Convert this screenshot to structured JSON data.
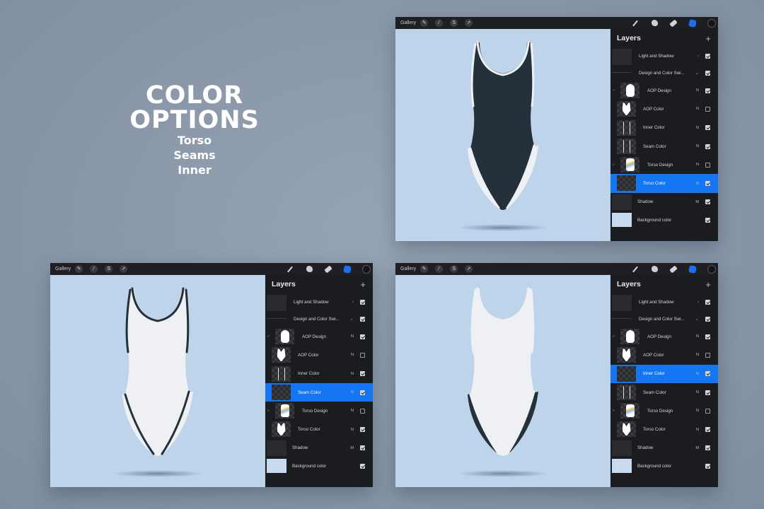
{
  "headline": {
    "title_line1": "COLOR",
    "title_line2": "OPTIONS",
    "options": [
      "Torso",
      "Seams",
      "Inner"
    ]
  },
  "colors": {
    "background": "#8896a8",
    "canvas": "#bdd4ea",
    "toolbar": "#1e1f22",
    "layers_panel": "#1b1c1f",
    "selection": "#1476f2",
    "dark_fabric": "#24303a",
    "light_fabric": "#eef0f3"
  },
  "toolbar": {
    "gallery_label": "Gallery",
    "left_icons": [
      "wrench-icon",
      "magic-wand-icon",
      "selection-s-icon",
      "transform-arrow-icon"
    ],
    "right_icons": [
      "brush-icon",
      "smudge-icon",
      "eraser-icon",
      "layers-icon",
      "color-picker-icon"
    ]
  },
  "panels": [
    {
      "id": "torso",
      "suit": {
        "body": "dark",
        "seams": "light",
        "inner": "light"
      },
      "layers_title": "Layers",
      "add_label": "+",
      "selected_layer": "Torso Color"
    },
    {
      "id": "seams",
      "suit": {
        "body": "light",
        "seams": "dark",
        "inner": "light"
      },
      "layers_title": "Layers",
      "add_label": "+",
      "selected_layer": "Seam Color"
    },
    {
      "id": "inner",
      "suit": {
        "body": "light",
        "seams": "light",
        "inner": "dark"
      },
      "layers_title": "Layers",
      "add_label": "+",
      "selected_layer": "Inner Color"
    }
  ],
  "layers": [
    {
      "name": "Light and Shadow",
      "blend": "",
      "chevron": ">",
      "visible": true,
      "type": "group-closed"
    },
    {
      "name": "Design and Color Swi...",
      "blend": "",
      "chevron": "v",
      "visible": true,
      "type": "group-open"
    },
    {
      "name": "AOP Design",
      "blend": "N",
      "visible": true,
      "type": "clipped"
    },
    {
      "name": "AOP Color",
      "blend": "N",
      "visible": false,
      "type": "layer"
    },
    {
      "name": "Inner Color",
      "blend": "N",
      "visible": true,
      "type": "layer"
    },
    {
      "name": "Seam Color",
      "blend": "N",
      "visible": true,
      "type": "layer"
    },
    {
      "name": "Torso Design",
      "blend": "N",
      "visible": false,
      "type": "clipped"
    },
    {
      "name": "Torso Color",
      "blend": "N",
      "visible": true,
      "type": "layer"
    },
    {
      "name": "Shadow",
      "blend": "M",
      "visible": true,
      "type": "plain"
    },
    {
      "name": "Background color",
      "blend": "",
      "visible": true,
      "type": "background"
    }
  ]
}
